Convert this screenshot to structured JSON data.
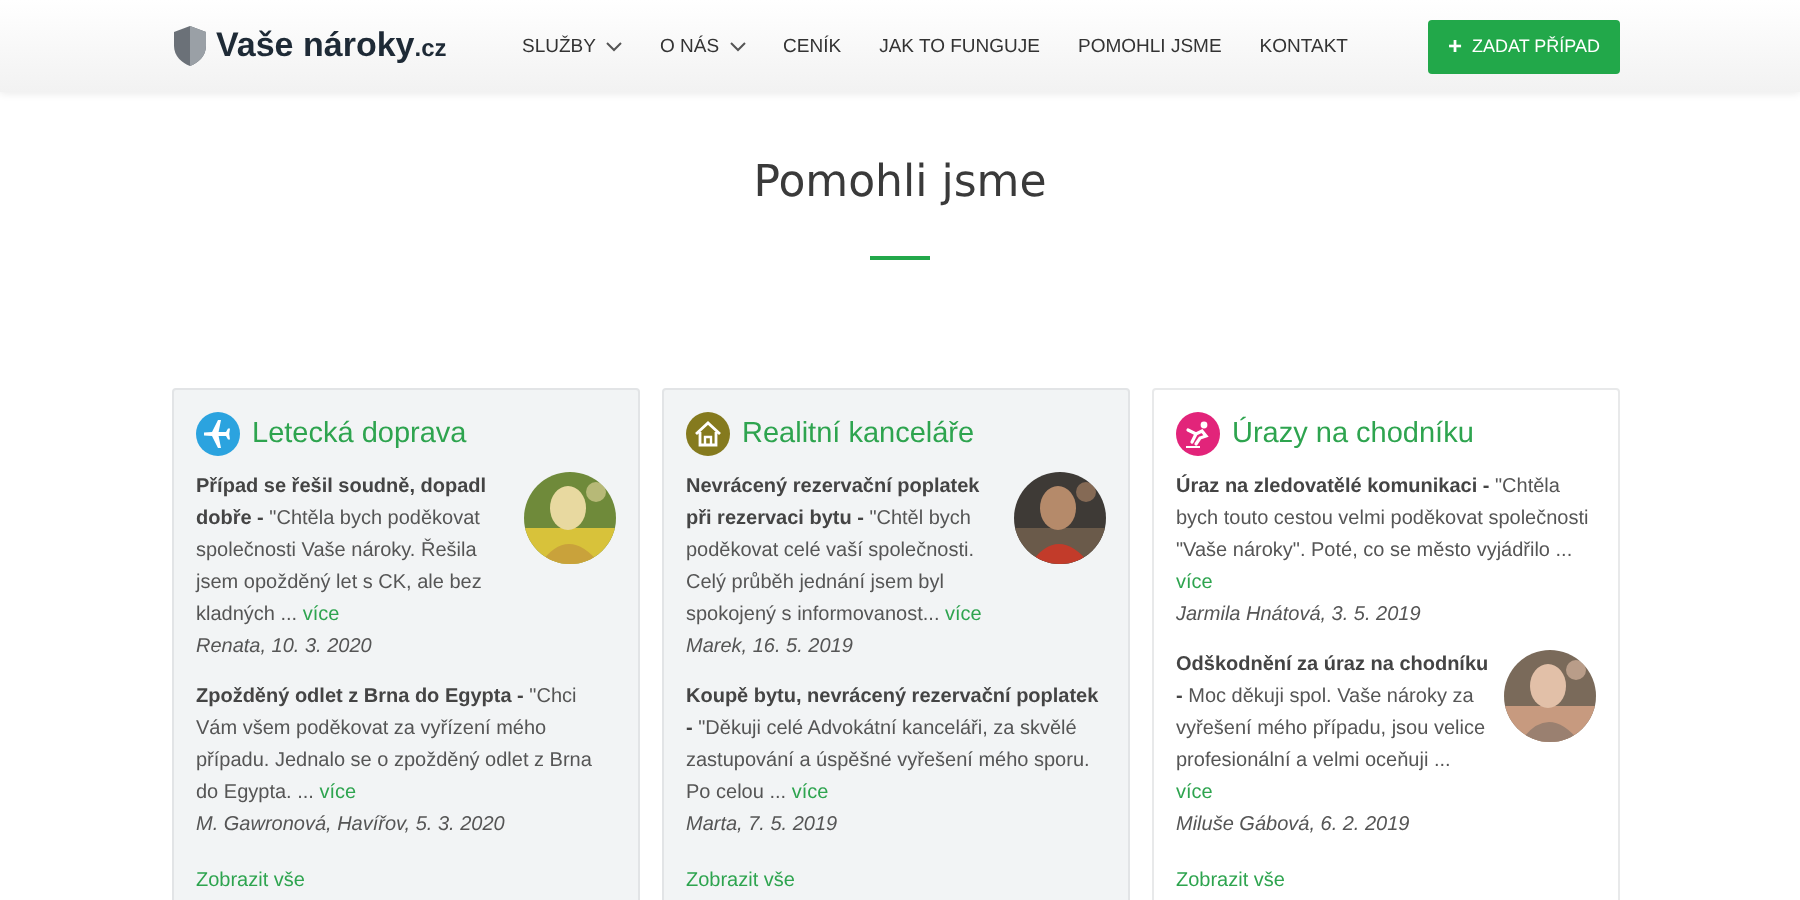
{
  "header": {
    "logo": {
      "name": "Vaše nároky",
      "suffix": ".cz"
    },
    "nav": [
      {
        "label": "SLUŽBY",
        "dropdown": true
      },
      {
        "label": "O NÁS",
        "dropdown": true
      },
      {
        "label": "CENÍK",
        "dropdown": false
      },
      {
        "label": "JAK TO FUNGUJE",
        "dropdown": false
      },
      {
        "label": "POMOHLI JSME",
        "dropdown": false
      },
      {
        "label": "KONTAKT",
        "dropdown": false
      }
    ],
    "cta": {
      "icon": "+",
      "label": "ZADAT PŘÍPAD"
    }
  },
  "page_title": "Pomohli jsme",
  "cards": [
    {
      "kind": "plane",
      "color": "#2ba3df",
      "title": "Letecká doprava",
      "shaded": true,
      "testimonials": [
        {
          "text": "**Případ se řešil soudně, dopadl dobře -** \"Chtěla bych poděkovat společnosti Vaše nároky. Řešila jsem opožděný let s CK, ale bez kladných ...",
          "link": "více",
          "author": "Renata, 10. 3. 2020"
        },
        {
          "text": "**Zpožděný odlet z Brna do Egypta -** \"Chci Vám všem poděkovat za vyřízení mého případu. Jednalo se o zpožděný odlet z Brna do Egypta. ...",
          "link": "více",
          "author": "M. Gawronová, Havířov, 5. 3. 2020"
        }
      ],
      "show_all": "Zobrazit vše"
    },
    {
      "kind": "house",
      "color": "#857a1e",
      "title": "Realitní kanceláře",
      "shaded": true,
      "testimonials": [
        {
          "text": "**Nevrácený rezervační poplatek při rezervaci bytu -** \"Chtěl bych poděkovat celé vaší společnosti. Celý průběh jednání jsem byl spokojený s informovanost...",
          "link": "více",
          "author": "Marek, 16. 5. 2019"
        },
        {
          "text": "**Koupě bytu, nevrácený rezervační poplatek -** \"Děkuji celé Advokátní kanceláři, za skvělé zastupování a úspěšné vyřešení mého sporu. Po celou ...",
          "link": "více",
          "author": "Marta, 7. 5. 2019"
        }
      ],
      "show_all": "Zobrazit vše"
    },
    {
      "kind": "fall",
      "color": "#e2247a",
      "title": "Úrazy na chodníku",
      "shaded": false,
      "testimonials": [
        {
          "text": "**Úraz na zledovatělé komunikaci -** \"Chtěla bych touto cestou velmi poděkovat společnosti \"Vaše nároky\". Poté, co se město vyjádřilo ...",
          "link": "více",
          "author": "Jarmila Hnátová, 3. 5. 2019"
        },
        {
          "text": "**Odškodnění za úraz na chodníku -** Moc děkuji spol. Vaše nároky za vyřešení mého případu, jsou velice profesionální a velmi oceňuji ...",
          "link": "více",
          "author": "Miluše Gábová, 6. 2. 2019"
        }
      ],
      "show_all": "Zobrazit vše"
    }
  ]
}
